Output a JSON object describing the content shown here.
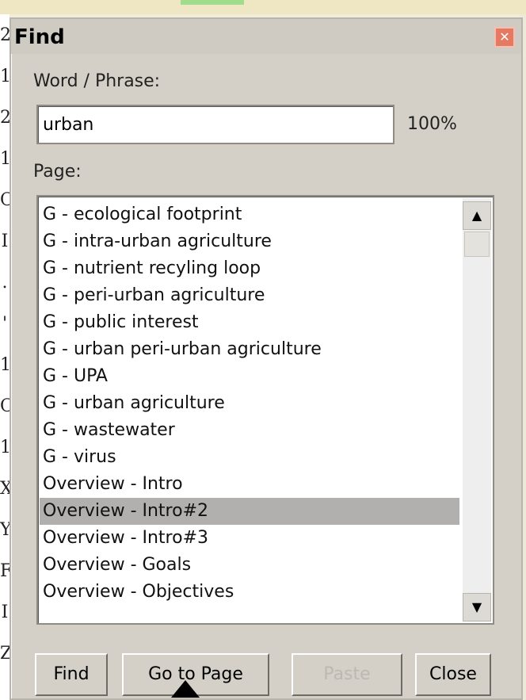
{
  "background": {
    "left_chars": [
      "2",
      "1",
      "2",
      "1",
      "C",
      "I",
      ".",
      "'",
      "1",
      "C",
      "1",
      "X",
      "Y",
      "F",
      "I",
      "Z"
    ]
  },
  "window": {
    "title": "Find",
    "close_icon": "close-icon"
  },
  "form": {
    "word_label": "Word / Phrase:",
    "word_value": "urban",
    "zoom": "100%",
    "page_label": "Page:"
  },
  "list": {
    "items": [
      "G - ecological footprint",
      "G - intra-urban agriculture",
      "G - nutrient recyling loop",
      "G - peri-urban agriculture",
      "G - public interest",
      "G - urban peri-urban agriculture",
      "G - UPA",
      "G - urban agriculture",
      "G - wastewater",
      "G - virus",
      "Overview - Intro",
      "Overview - Intro#2",
      "Overview - Intro#3",
      "Overview - Goals",
      "Overview - Objectives"
    ],
    "selected_index": 11
  },
  "buttons": {
    "find": "Find",
    "goto": "Go to Page",
    "paste": "Paste",
    "close": "Close"
  },
  "colors": {
    "dialog": "#d4d0c8",
    "selection": "#b1b0ae",
    "close_button": "#e57a62"
  }
}
